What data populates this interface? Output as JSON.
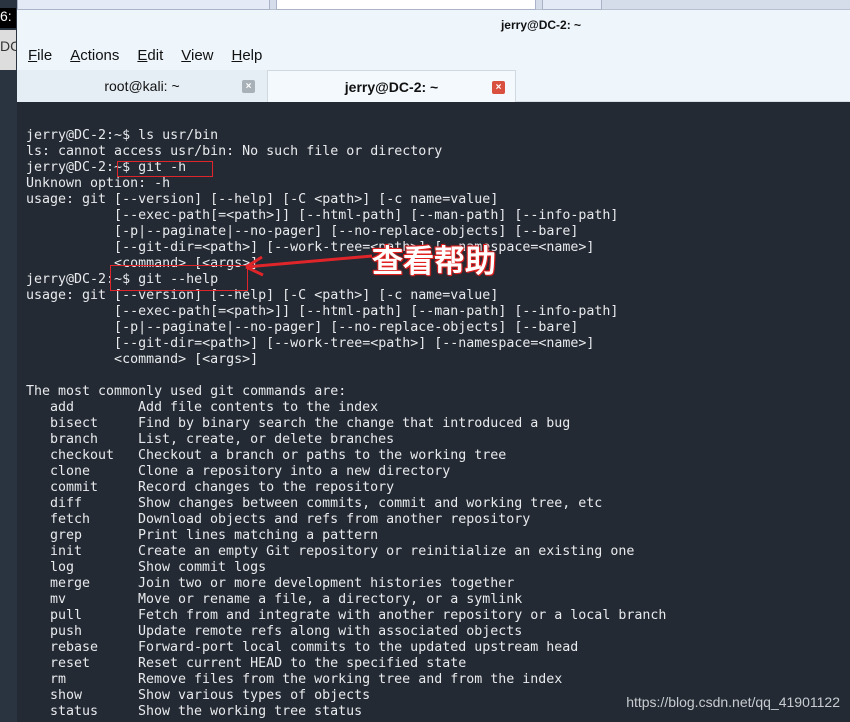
{
  "desktop": {
    "clock_fragment": "6:",
    "label_fragment": "DC"
  },
  "window": {
    "title": "jerry@DC-2: ~"
  },
  "menu": [
    "File",
    "Actions",
    "Edit",
    "View",
    "Help"
  ],
  "tabs": [
    {
      "label": "root@kali: ~",
      "active": false
    },
    {
      "label": "jerry@DC-2: ~",
      "active": true
    }
  ],
  "terminal": {
    "lines": [
      "jerry@DC-2:~$ ls usr/bin",
      "ls: cannot access usr/bin: No such file or directory",
      "jerry@DC-2:~$ git -h",
      "Unknown option: -h",
      "usage: git [--version] [--help] [-C <path>] [-c name=value]",
      "           [--exec-path[=<path>]] [--html-path] [--man-path] [--info-path]",
      "           [-p|--paginate|--no-pager] [--no-replace-objects] [--bare]",
      "           [--git-dir=<path>] [--work-tree=<path>] [--namespace=<name>]",
      "           <command> [<args>]",
      "jerry@DC-2:~$ git --help",
      "usage: git [--version] [--help] [-C <path>] [-c name=value]",
      "           [--exec-path[=<path>]] [--html-path] [--man-path] [--info-path]",
      "           [-p|--paginate|--no-pager] [--no-replace-objects] [--bare]",
      "           [--git-dir=<path>] [--work-tree=<path>] [--namespace=<name>]",
      "           <command> [<args>]",
      "",
      "The most commonly used git commands are:"
    ],
    "commands": [
      {
        "name": "add",
        "desc": "Add file contents to the index"
      },
      {
        "name": "bisect",
        "desc": "Find by binary search the change that introduced a bug"
      },
      {
        "name": "branch",
        "desc": "List, create, or delete branches"
      },
      {
        "name": "checkout",
        "desc": "Checkout a branch or paths to the working tree"
      },
      {
        "name": "clone",
        "desc": "Clone a repository into a new directory"
      },
      {
        "name": "commit",
        "desc": "Record changes to the repository"
      },
      {
        "name": "diff",
        "desc": "Show changes between commits, commit and working tree, etc"
      },
      {
        "name": "fetch",
        "desc": "Download objects and refs from another repository"
      },
      {
        "name": "grep",
        "desc": "Print lines matching a pattern"
      },
      {
        "name": "init",
        "desc": "Create an empty Git repository or reinitialize an existing one"
      },
      {
        "name": "log",
        "desc": "Show commit logs"
      },
      {
        "name": "merge",
        "desc": "Join two or more development histories together"
      },
      {
        "name": "mv",
        "desc": "Move or rename a file, a directory, or a symlink"
      },
      {
        "name": "pull",
        "desc": "Fetch from and integrate with another repository or a local branch"
      },
      {
        "name": "push",
        "desc": "Update remote refs along with associated objects"
      },
      {
        "name": "rebase",
        "desc": "Forward-port local commits to the updated upstream head"
      },
      {
        "name": "reset",
        "desc": "Reset current HEAD to the specified state"
      },
      {
        "name": "rm",
        "desc": "Remove files from the working tree and from the index"
      },
      {
        "name": "show",
        "desc": "Show various types of objects"
      },
      {
        "name": "status",
        "desc": "Show the working tree status"
      }
    ]
  },
  "annotation": {
    "text": "查看帮助",
    "color": "#e0252a"
  },
  "watermark": "https://blog.csdn.net/qq_41901122",
  "colors": {
    "terminal_bg": "#232a33",
    "terminal_fg": "#e8eaed",
    "close_active": "#d9503f"
  }
}
